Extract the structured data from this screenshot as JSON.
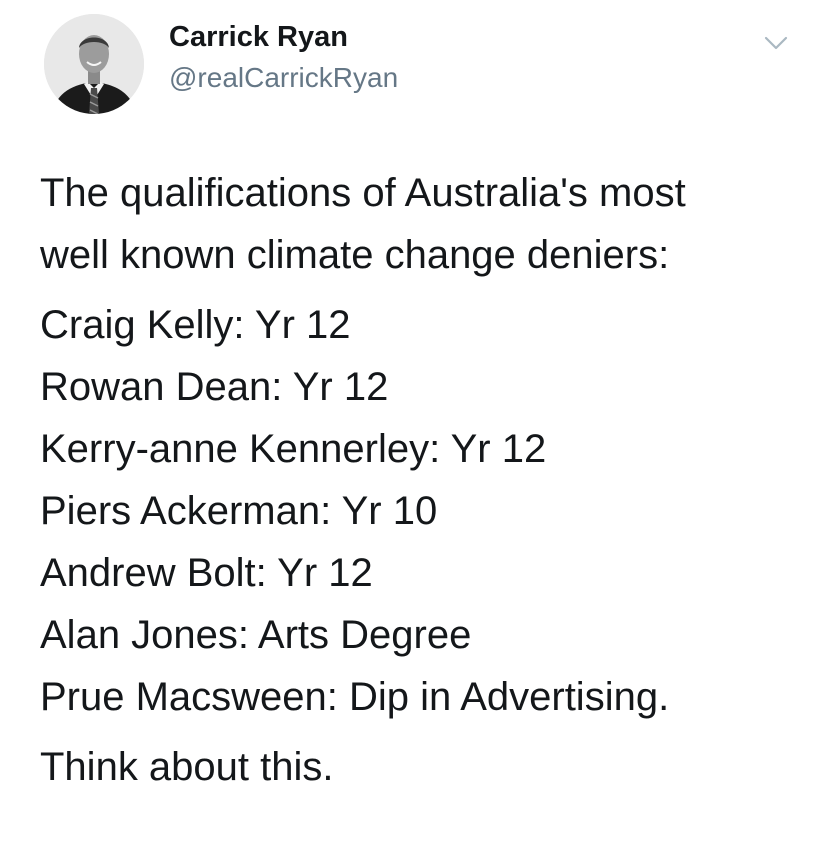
{
  "author": {
    "name": "Carrick Ryan",
    "handle": "@realCarrickRyan",
    "avatar_icon": "profile-photo"
  },
  "menu": {
    "icon": "chevron-down-icon"
  },
  "tweet": {
    "intro": [
      "The qualifications of Australia's most",
      "well known climate change deniers:"
    ],
    "list": [
      "Craig Kelly: Yr 12",
      "Rowan Dean: Yr 12",
      "Kerry-anne Kennerley: Yr 12",
      "Piers Ackerman: Yr 10",
      "Andrew Bolt: Yr 12",
      "Alan Jones: Arts Degree",
      "Prue Macsween: Dip in Advertising."
    ],
    "closing": "Think about this."
  },
  "colors": {
    "text": "#14171a",
    "handle": "#657786",
    "chevron": "#aab8c2"
  }
}
